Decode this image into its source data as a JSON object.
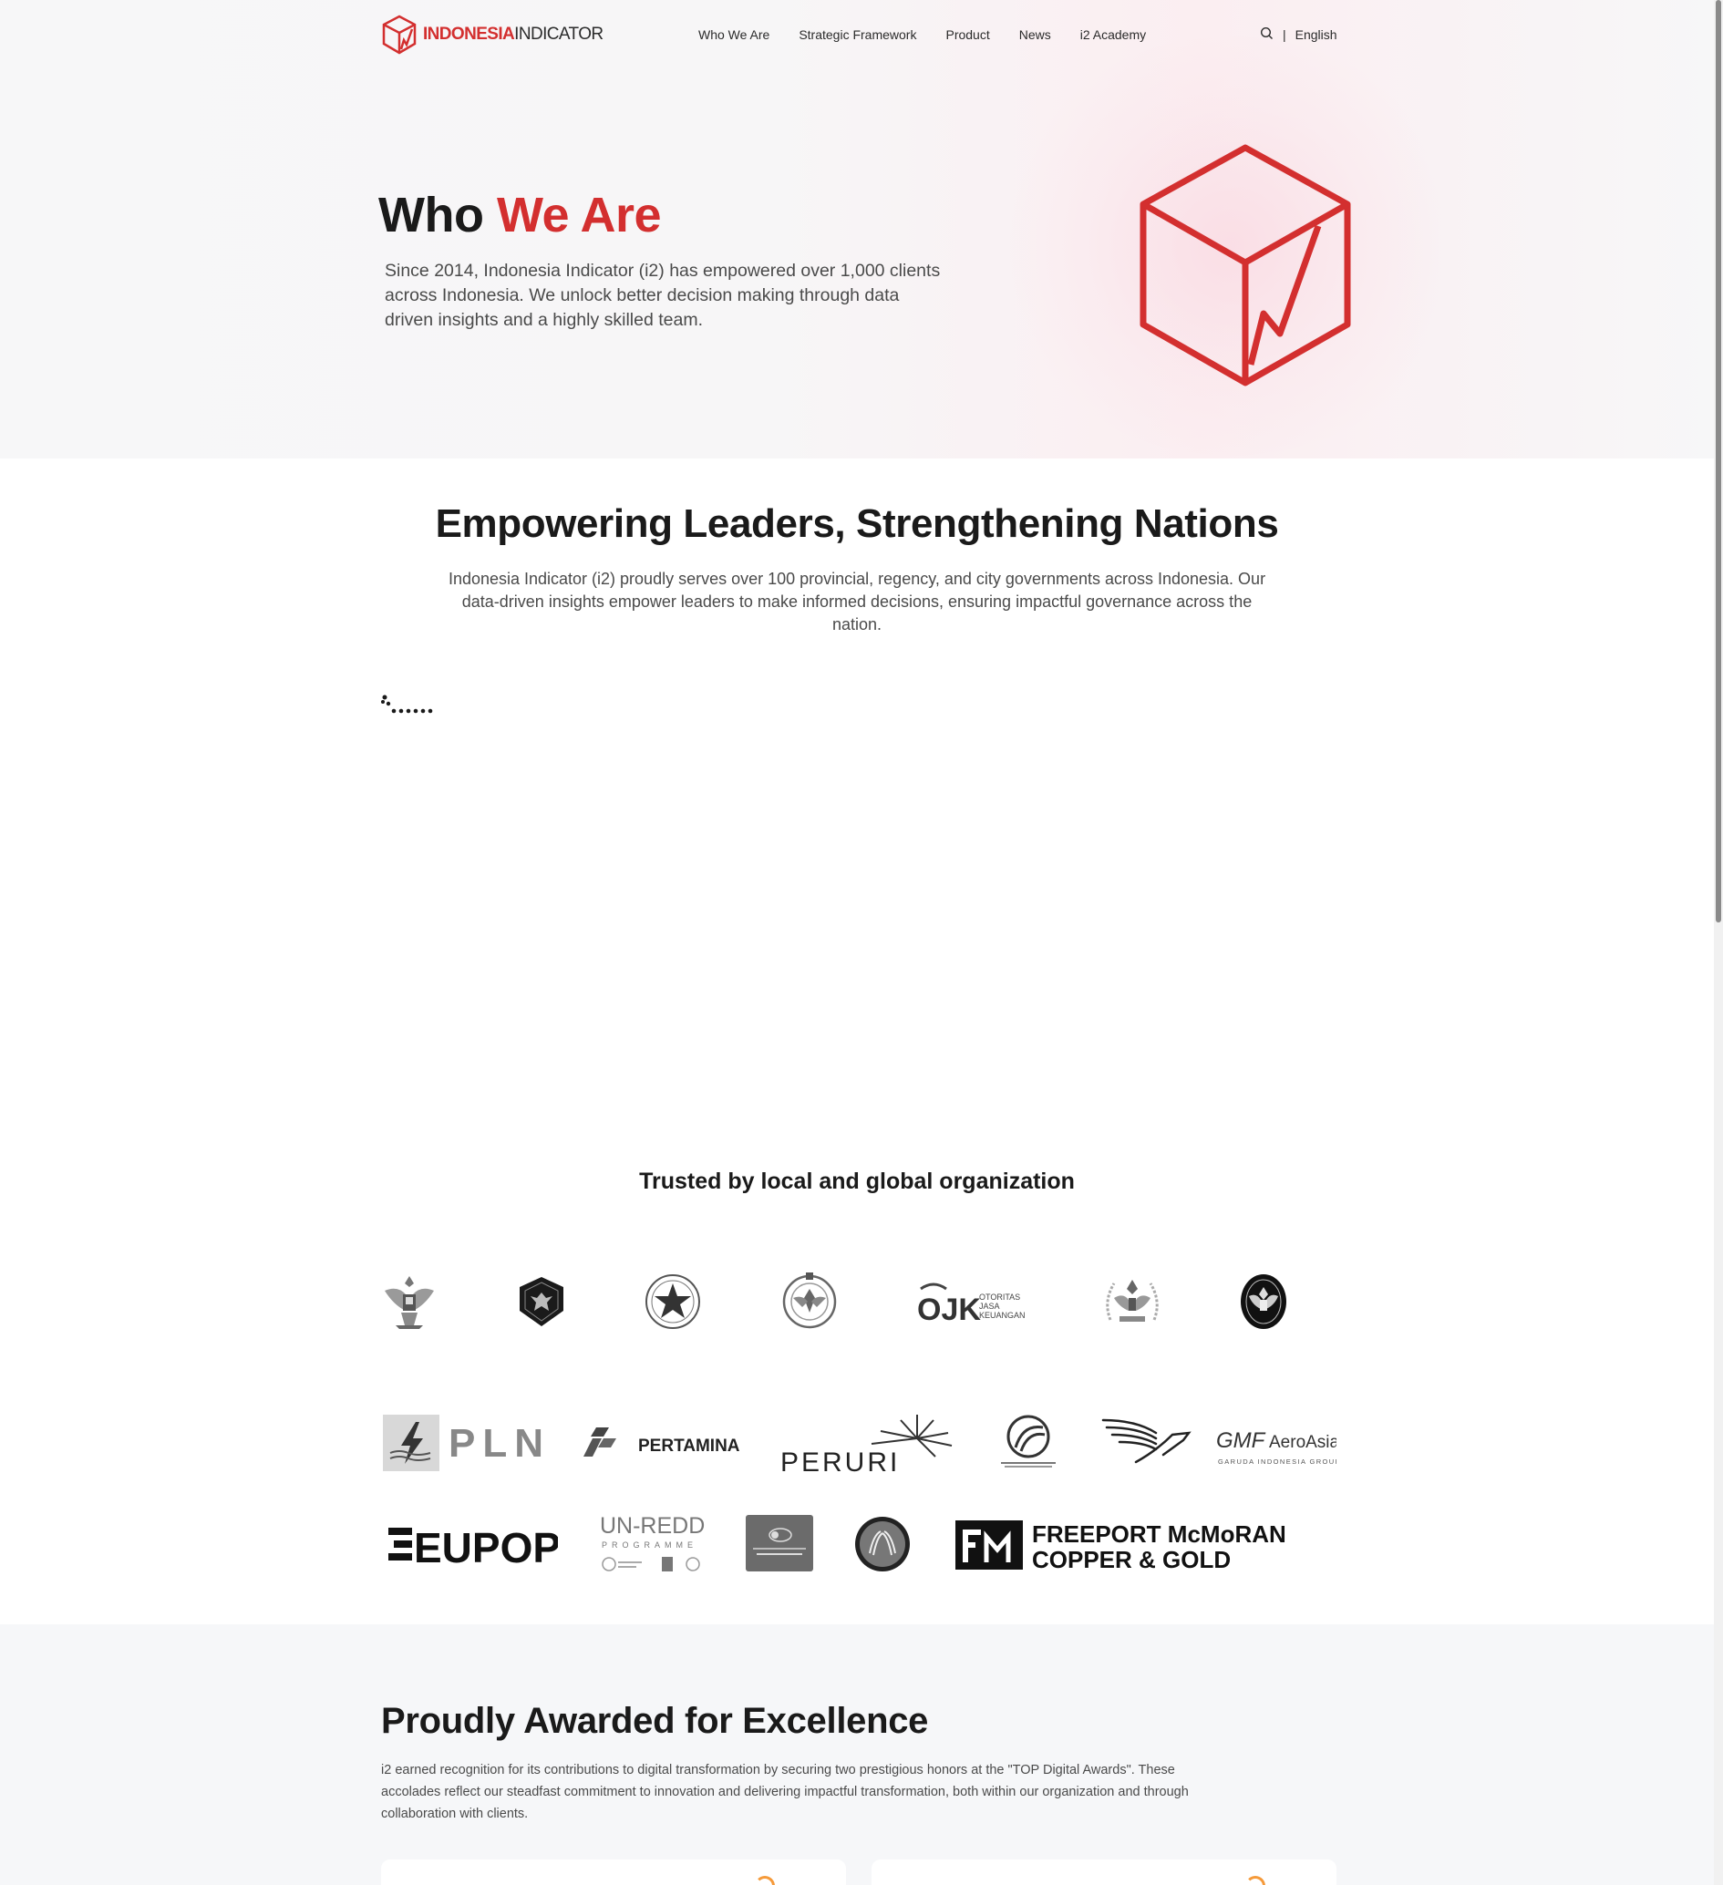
{
  "nav": {
    "logo_red": "INDONESIA",
    "logo_dark": "INDICATOR",
    "links": [
      "Who We Are",
      "Strategic Framework",
      "Product",
      "News",
      "i2 Academy"
    ],
    "separator": "|",
    "language": "English"
  },
  "hero": {
    "title_plain": "Who ",
    "title_accent": "We Are",
    "description": "Since 2014, Indonesia Indicator (i2) has empowered over 1,000 clients across Indonesia. We unlock better decision making through data driven insights and a highly skilled team."
  },
  "section2": {
    "title": "Empowering Leaders, Strengthening Nations",
    "description": "Indonesia Indicator (i2) proudly serves over 100 provincial, regency, and city governments across Indonesia. Our data-driven insights empower leaders to make informed decisions, ensuring impactful governance across the nation."
  },
  "trusted": {
    "title": "Trusted by local and global organization",
    "logos": {
      "ojk_mark": "OJK",
      "ojk_line1": "OTORITAS",
      "ojk_line2": "JASA",
      "ojk_line3": "KEUANGAN",
      "pln": "PLN",
      "pertamina": "PERTAMINA",
      "peruri": "PERURI",
      "gmf_main": "GMF",
      "gmf_sub": "AeroAsia",
      "gmf_tag": "GARUDA INDONESIA GROUP",
      "eupop": "EUPOP",
      "unredd_main": "UN-REDD",
      "unredd_sub": "PROGRAMME",
      "freeport_line1": "FREEPORT McMoRAN",
      "freeport_line2": "COPPER & GOLD"
    }
  },
  "awards": {
    "title": "Proudly Awarded for Excellence",
    "description": "i2 earned recognition for its contributions to digital transformation by securing two prestigious honors at the \"TOP Digital Awards\". These accolades reflect our steadfast commitment to innovation and delivering impactful transformation, both within our organization and through collaboration with clients."
  },
  "colors": {
    "brand_red": "#d32f2f",
    "awards_bg": "#f6f7f9",
    "loader_accent": "#f59a3a"
  }
}
